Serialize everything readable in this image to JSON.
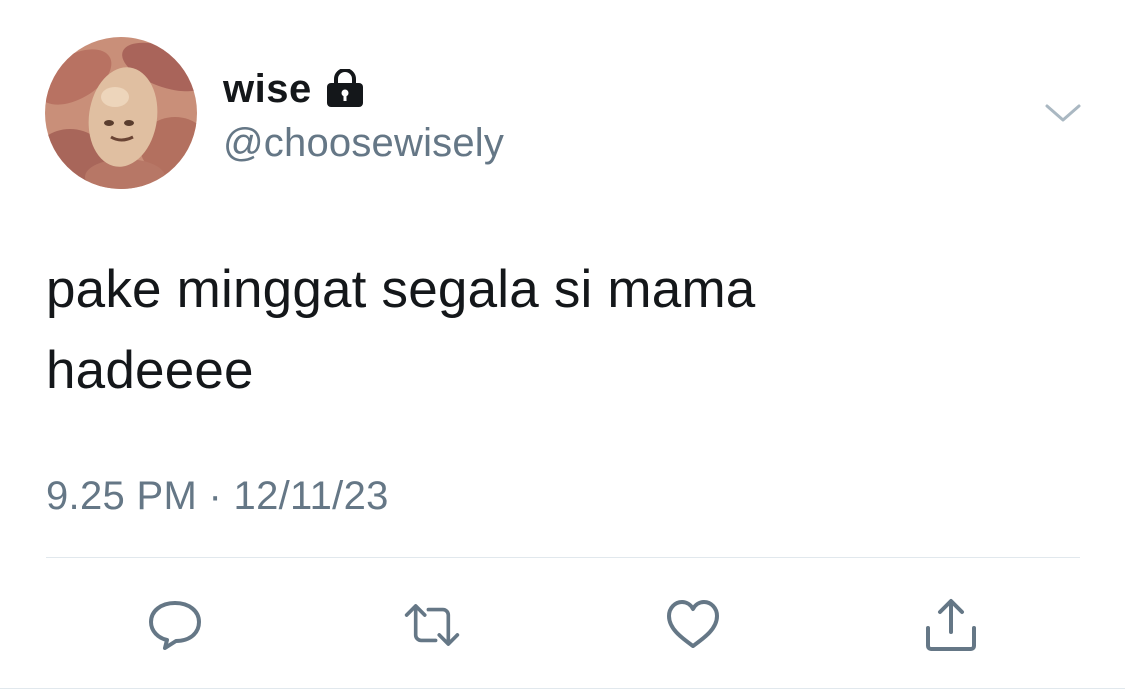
{
  "user": {
    "display_name": "wise",
    "handle": "@choosewisely",
    "protected_icon": "lock-icon"
  },
  "tweet": {
    "lines": [
      "pake minggat segala si mama",
      "hadeeee"
    ],
    "time": "9.25 PM",
    "separator": "·",
    "date": "12/11/23"
  },
  "actions": [
    {
      "name": "reply",
      "icon": "reply-bubble-icon"
    },
    {
      "name": "retweet",
      "icon": "retweet-icon"
    },
    {
      "name": "like",
      "icon": "heart-icon"
    },
    {
      "name": "share",
      "icon": "share-icon"
    }
  ],
  "colors": {
    "text": "#14171a",
    "secondary": "#657786",
    "divider": "#e1e8ed"
  }
}
